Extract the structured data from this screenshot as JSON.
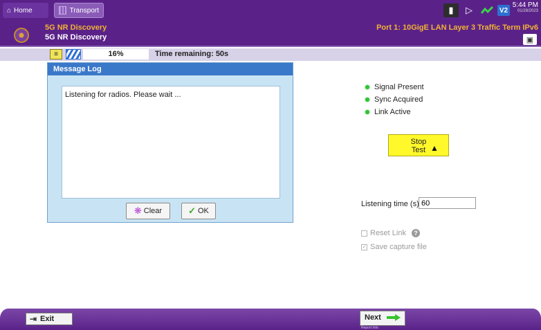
{
  "system_bar": {
    "home_label": "Home",
    "transport_label": "Transport",
    "time": "5:44 PM",
    "date": "01/28/2023",
    "v2_label": "V2",
    "icons": [
      "battery-icon",
      "speaker-icon",
      "network-check-icon",
      "v2-icon"
    ]
  },
  "header": {
    "breadcrumb_top": "5G NR Discovery",
    "breadcrumb_bottom": "5G NR Discovery",
    "port_label": "Port 1: 10GigE LAN Layer 3 Traffic Term IPv6",
    "icons": [
      "logo-icon",
      "camera-icon"
    ]
  },
  "progress": {
    "percent_label": "16%",
    "percent_value": 16,
    "time_remaining": "Time remaining: 50s"
  },
  "message_log": {
    "title": "Message Log",
    "content": "Listening for radios. Please wait ...",
    "clear_label": "Clear",
    "ok_label": "OK"
  },
  "status": {
    "items": [
      {
        "label": "Signal Present",
        "color": "#2fc236"
      },
      {
        "label": "Sync Acquired",
        "color": "#2fc236"
      },
      {
        "label": "Link Active",
        "color": "#2fc236"
      }
    ]
  },
  "controls": {
    "stop_line1": "Stop",
    "stop_line2": "Test",
    "listening_label": "Listening time (s)",
    "listening_value": "60",
    "reset_link_label": "Reset Link",
    "save_capture_label": "Save capture file"
  },
  "bottom_bar": {
    "exit_label": "Exit",
    "next_label": "Next",
    "next_sublabel": "Report Info"
  },
  "colors": {
    "brand_purple": "#5a2289",
    "accent_orange": "#f2b233",
    "stop_yellow": "#fff82a",
    "dialog_title_blue": "#3a78c9",
    "status_green": "#2fc236"
  }
}
